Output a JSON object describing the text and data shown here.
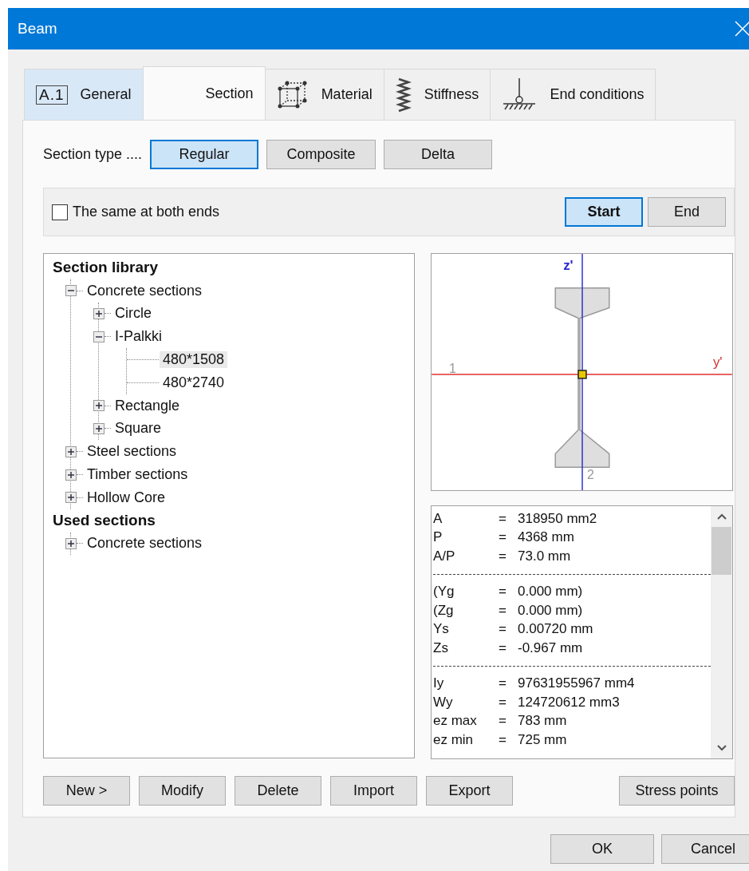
{
  "window": {
    "title": "Beam"
  },
  "tabs": [
    {
      "label": "General",
      "icon_text": "A.1",
      "selected": false
    },
    {
      "label": "Section",
      "selected": true
    },
    {
      "label": "Material",
      "selected": false
    },
    {
      "label": "Stiffness",
      "selected": false
    },
    {
      "label": "End conditions",
      "selected": false
    }
  ],
  "section_type": {
    "label": "Section type ....",
    "options": [
      {
        "label": "Regular",
        "selected": true
      },
      {
        "label": "Composite",
        "selected": false
      },
      {
        "label": "Delta",
        "selected": false
      }
    ]
  },
  "ends": {
    "same_label": "The same at both ends",
    "checked": false,
    "options": [
      {
        "label": "Start",
        "selected": true
      },
      {
        "label": "End",
        "selected": false
      }
    ]
  },
  "tree": [
    {
      "label": "Section library",
      "kind": "heading",
      "children": [
        {
          "label": "Concrete sections",
          "expanded": true,
          "children": [
            {
              "label": "Circle",
              "expanded": false
            },
            {
              "label": "I-Palkki",
              "expanded": true,
              "children": [
                {
                  "label": "480*1508",
                  "selected": true
                },
                {
                  "label": "480*2740",
                  "selected": false
                }
              ]
            },
            {
              "label": "Rectangle",
              "expanded": false
            },
            {
              "label": "Square",
              "expanded": false
            }
          ]
        },
        {
          "label": "Steel sections",
          "expanded": false
        },
        {
          "label": "Timber sections",
          "expanded": false
        },
        {
          "label": "Hollow Core",
          "expanded": false
        }
      ]
    },
    {
      "label": "Used sections",
      "kind": "heading",
      "children": [
        {
          "label": "Concrete sections",
          "expanded": false
        }
      ]
    }
  ],
  "preview": {
    "z_axis": "z'",
    "y_axis": "y'",
    "point_1": "1",
    "point_2": "2"
  },
  "properties": [
    {
      "kind": "row",
      "name": "A",
      "value": "318950 mm2"
    },
    {
      "kind": "row",
      "name": "P",
      "value": "4368 mm"
    },
    {
      "kind": "row",
      "name": "A/P",
      "value": "73.0 mm"
    },
    {
      "kind": "separator"
    },
    {
      "kind": "row",
      "name": "(Yg",
      "value": "0.000 mm)"
    },
    {
      "kind": "row",
      "name": "(Zg",
      "value": "0.000 mm)"
    },
    {
      "kind": "row",
      "name": "Ys",
      "value": "0.00720 mm"
    },
    {
      "kind": "row",
      "name": "Zs",
      "value": "-0.967 mm"
    },
    {
      "kind": "separator"
    },
    {
      "kind": "row",
      "name": "Iy",
      "value": "97631955967 mm4"
    },
    {
      "kind": "row",
      "name": "Wy",
      "value": "124720612 mm3"
    },
    {
      "kind": "row",
      "name": "ez max",
      "value": "783 mm"
    },
    {
      "kind": "row",
      "name": "ez min",
      "value": "725 mm"
    }
  ],
  "equals": "=",
  "library_buttons": [
    "New >",
    "Modify",
    "Delete",
    "Import",
    "Export"
  ],
  "stress_button": "Stress points",
  "buttons": [
    "OK",
    "Cancel"
  ]
}
